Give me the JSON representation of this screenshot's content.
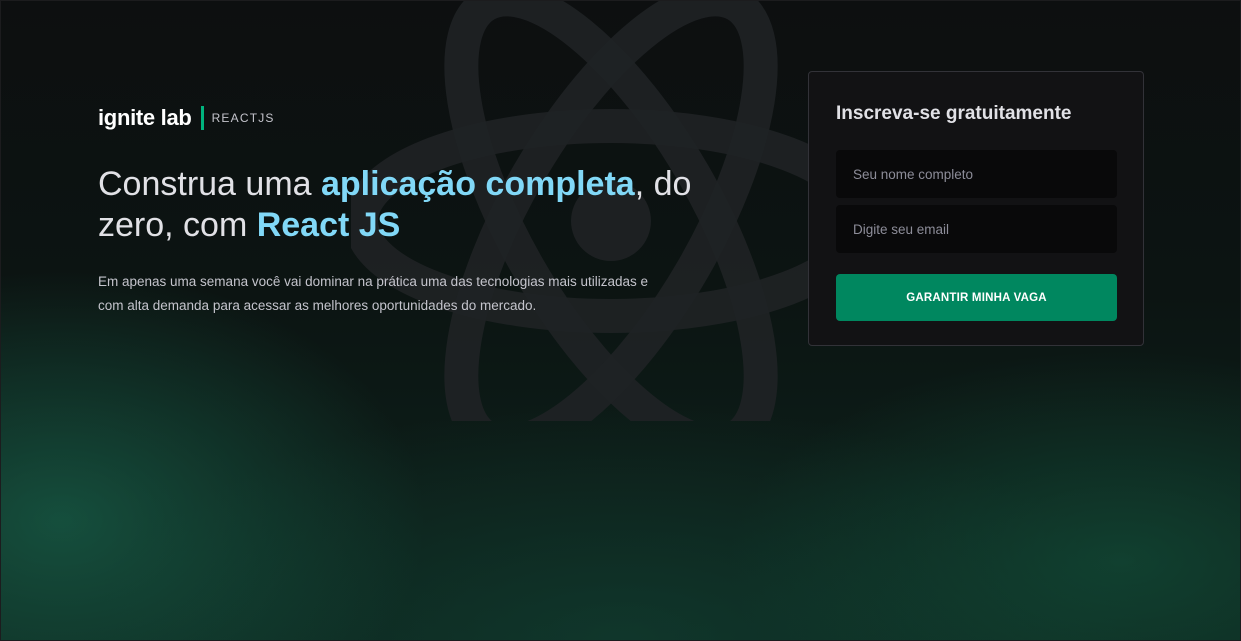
{
  "brand": {
    "name": "ignite lab",
    "tag": "REACTJS",
    "accent_color": "#00b37e"
  },
  "hero": {
    "headline_prefix": "Construa uma ",
    "headline_highlight_1": "aplicação completa",
    "headline_mid": ", do zero, com ",
    "headline_highlight_2": "React JS",
    "description": "Em apenas uma semana você vai dominar na prática uma das tecnologias mais utilizadas e com alta demanda para acessar as melhores oportunidades do mercado.",
    "highlight_color": "#81d8f7"
  },
  "signup": {
    "title": "Inscreva-se gratuitamente",
    "name_placeholder": "Seu nome completo",
    "email_placeholder": "Digite seu email",
    "button_label": "GARANTIR MINHA VAGA",
    "button_color": "#00875f"
  },
  "background": {
    "icon": "react-logo-icon"
  }
}
